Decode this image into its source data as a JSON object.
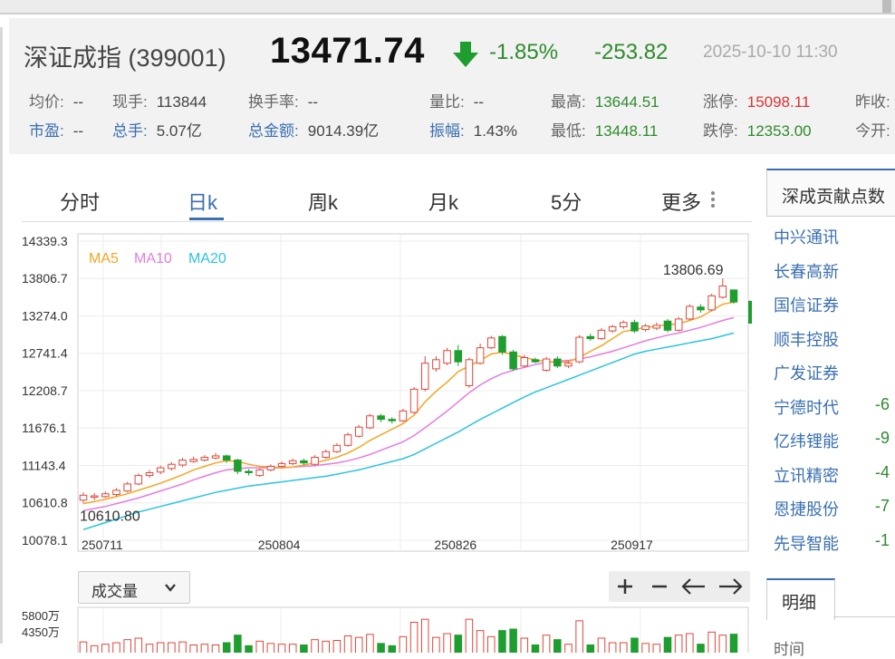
{
  "quote": {
    "name": "深证成指 (399001)",
    "price": "13471.74",
    "change_pct": "-1.85%",
    "change": "-253.82",
    "datetime": "2025-10-10 11:30",
    "row1": [
      {
        "label": "均价:",
        "value": "--",
        "color": "default"
      },
      {
        "label": "现手:",
        "value": "113844",
        "color": "default"
      },
      {
        "label": "换手率:",
        "value": "--",
        "color": "default"
      },
      {
        "label": "量比:",
        "value": "--",
        "color": "default"
      },
      {
        "label": "最高:",
        "value": "13644.51",
        "color": "green"
      },
      {
        "label": "涨停:",
        "value": "15098.11",
        "color": "red"
      },
      {
        "label": "昨收:",
        "value": "",
        "color": "default"
      }
    ],
    "row2": [
      {
        "label": "市盈:",
        "value": "--",
        "color": "default"
      },
      {
        "label": "总手:",
        "value": "5.07亿",
        "color": "default"
      },
      {
        "label": "总金额:",
        "value": "9014.39亿",
        "color": "default"
      },
      {
        "label": "振幅:",
        "value": "1.43%",
        "color": "default"
      },
      {
        "label": "最低:",
        "value": "13448.11",
        "color": "green"
      },
      {
        "label": "跌停:",
        "value": "12353.00",
        "color": "green"
      },
      {
        "label": "今开:",
        "value": "",
        "color": "default"
      }
    ]
  },
  "tabs": [
    "分时",
    "日k",
    "周k",
    "月k",
    "5分",
    "更多"
  ],
  "active_tab": "日k",
  "controls": {
    "volume_select": "成交量",
    "zoom_in": "+",
    "zoom_out": "−",
    "left": "←",
    "right": "→"
  },
  "colors": {
    "up": "#e0473a",
    "down": "#1e9e2e",
    "ma5": "#f5a623",
    "ma10": "#e57ce0",
    "ma20": "#2bc4e0",
    "accent": "#3a6fb0"
  },
  "chart_data": {
    "type": "candlestick",
    "ylim": [
      10078.1,
      14339.3
    ],
    "y_ticks": [
      "14339.3",
      "13806.7",
      "13274.0",
      "12741.4",
      "12208.7",
      "11676.1",
      "11143.4",
      "10610.8",
      "10078.1"
    ],
    "x_tick_labels": [
      {
        "label": "250711",
        "index": 0
      },
      {
        "label": "250804",
        "index": 16
      },
      {
        "label": "250826",
        "index": 32
      },
      {
        "label": "250917",
        "index": 48
      }
    ],
    "legend": [
      "MA5",
      "MA10",
      "MA20"
    ],
    "max_label": "13806.69",
    "min_label": "10610.80",
    "candles": [
      [
        10650,
        10720,
        10760,
        10610.8
      ],
      [
        10690,
        10710,
        10750,
        10650
      ],
      [
        10700,
        10740,
        10770,
        10680
      ],
      [
        10730,
        10790,
        10820,
        10700
      ],
      [
        10780,
        10880,
        10910,
        10760
      ],
      [
        10880,
        11000,
        11030,
        10860
      ],
      [
        11000,
        11040,
        11080,
        10970
      ],
      [
        11050,
        11110,
        11140,
        11020
      ],
      [
        11100,
        11160,
        11190,
        11070
      ],
      [
        11150,
        11220,
        11250,
        11120
      ],
      [
        11200,
        11230,
        11270,
        11180
      ],
      [
        11220,
        11260,
        11290,
        11200
      ],
      [
        11250,
        11280,
        11320,
        11230
      ],
      [
        11280,
        11220,
        11300,
        11180
      ],
      [
        11220,
        11060,
        11240,
        11020
      ],
      [
        11060,
        11040,
        11090,
        11000
      ],
      [
        11000,
        11080,
        11100,
        10980
      ],
      [
        11080,
        11130,
        11160,
        11060
      ],
      [
        11130,
        11170,
        11200,
        11110
      ],
      [
        11170,
        11210,
        11240,
        11150
      ],
      [
        11210,
        11180,
        11240,
        11150
      ],
      [
        11160,
        11260,
        11290,
        11140
      ],
      [
        11260,
        11340,
        11370,
        11240
      ],
      [
        11340,
        11430,
        11460,
        11320
      ],
      [
        11430,
        11580,
        11610,
        11410
      ],
      [
        11560,
        11690,
        11720,
        11540
      ],
      [
        11680,
        11850,
        11880,
        11660
      ],
      [
        11850,
        11800,
        11880,
        11760
      ],
      [
        11800,
        11780,
        11830,
        11740
      ],
      [
        11780,
        11920,
        11950,
        11760
      ],
      [
        11900,
        12230,
        12260,
        11880
      ],
      [
        12230,
        12600,
        12700,
        12200
      ],
      [
        12520,
        12650,
        12700,
        12480
      ],
      [
        12600,
        12780,
        12820,
        12570
      ],
      [
        12780,
        12620,
        12860,
        12560
      ],
      [
        12280,
        12650,
        12680,
        12250
      ],
      [
        12600,
        12820,
        12880,
        12580
      ],
      [
        12820,
        12960,
        12990,
        12800
      ],
      [
        12980,
        12760,
        13000,
        12720
      ],
      [
        12760,
        12520,
        12790,
        12490
      ],
      [
        12560,
        12680,
        12720,
        12540
      ],
      [
        12650,
        12620,
        12680,
        12600
      ],
      [
        12500,
        12660,
        12690,
        12480
      ],
      [
        12660,
        12560,
        12700,
        12530
      ],
      [
        12560,
        12600,
        12630,
        12530
      ],
      [
        12620,
        12970,
        13000,
        12600
      ],
      [
        12980,
        12950,
        13020,
        12920
      ],
      [
        12950,
        13070,
        13100,
        12930
      ],
      [
        13060,
        13120,
        13150,
        13030
      ],
      [
        13120,
        13180,
        13210,
        13090
      ],
      [
        13180,
        13060,
        13220,
        13030
      ],
      [
        13080,
        13130,
        13160,
        13050
      ],
      [
        13100,
        13140,
        13180,
        13070
      ],
      [
        13200,
        13070,
        13230,
        13040
      ],
      [
        13070,
        13230,
        13260,
        13050
      ],
      [
        13230,
        13410,
        13440,
        13210
      ],
      [
        13400,
        13360,
        13440,
        13320
      ],
      [
        13360,
        13560,
        13590,
        13340
      ],
      [
        13540,
        13700,
        13806.69,
        13520
      ],
      [
        13644,
        13471.74,
        13644.51,
        13448.11
      ]
    ],
    "ma5": [
      10600,
      10630,
      10660,
      10700,
      10740,
      10790,
      10840,
      10890,
      10950,
      11010,
      11080,
      11130,
      11180,
      11210,
      11200,
      11160,
      11130,
      11120,
      11110,
      11120,
      11150,
      11180,
      11220,
      11260,
      11320,
      11400,
      11500,
      11580,
      11660,
      11740,
      11860,
      12050,
      12200,
      12330,
      12480,
      12560,
      12640,
      12730,
      12760,
      12720,
      12680,
      12650,
      12620,
      12610,
      12620,
      12680,
      12770,
      12850,
      12950,
      13050,
      13080,
      13110,
      13130,
      13150,
      13160,
      13210,
      13260,
      13350,
      13440,
      13470
    ],
    "ma10": [
      10500,
      10530,
      10560,
      10600,
      10640,
      10680,
      10730,
      10780,
      10830,
      10880,
      10940,
      10990,
      11040,
      11080,
      11100,
      11110,
      11110,
      11110,
      11110,
      11120,
      11130,
      11140,
      11160,
      11180,
      11210,
      11250,
      11300,
      11360,
      11420,
      11480,
      11570,
      11680,
      11800,
      11920,
      12050,
      12180,
      12290,
      12380,
      12450,
      12500,
      12540,
      12580,
      12610,
      12630,
      12640,
      12660,
      12690,
      12730,
      12770,
      12820,
      12870,
      12920,
      12960,
      13000,
      13030,
      13070,
      13110,
      13160,
      13210,
      13250
    ],
    "ma20": [
      10230,
      10280,
      10330,
      10380,
      10430,
      10480,
      10520,
      10560,
      10600,
      10640,
      10680,
      10720,
      10760,
      10790,
      10820,
      10850,
      10870,
      10890,
      10910,
      10930,
      10950,
      10970,
      10990,
      11020,
      11050,
      11080,
      11120,
      11160,
      11200,
      11240,
      11300,
      11380,
      11460,
      11540,
      11620,
      11710,
      11800,
      11880,
      11960,
      12040,
      12120,
      12190,
      12250,
      12310,
      12370,
      12430,
      12490,
      12550,
      12610,
      12670,
      12730,
      12770,
      12800,
      12830,
      12860,
      12890,
      12920,
      12950,
      12990,
      13030
    ],
    "volume_ticks": [
      "5800万",
      "4350万"
    ]
  },
  "side_panel": {
    "title": "深成贡献点数",
    "items": [
      {
        "name": "中兴通讯",
        "value": ""
      },
      {
        "name": "长春高新",
        "value": ""
      },
      {
        "name": "国信证券",
        "value": ""
      },
      {
        "name": "顺丰控股",
        "value": ""
      },
      {
        "name": "广发证券",
        "value": ""
      },
      {
        "name": "宁德时代",
        "value": "-6"
      },
      {
        "name": "亿纬锂能",
        "value": "-9"
      },
      {
        "name": "立讯精密",
        "value": "-4"
      },
      {
        "name": "恩捷股份",
        "value": "-7"
      },
      {
        "name": "先导智能",
        "value": "-1"
      }
    ]
  },
  "detail": {
    "tab": "明细",
    "sub_label": "时间"
  }
}
